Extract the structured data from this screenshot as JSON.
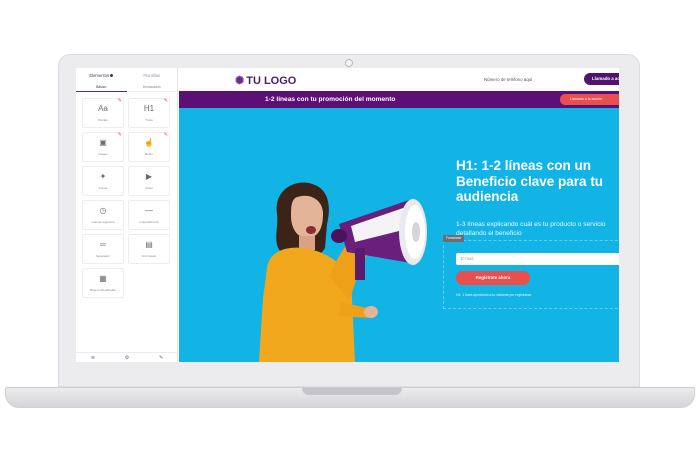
{
  "sidebar": {
    "tabs": [
      {
        "label": "Elementos"
      },
      {
        "label": "Plantillas"
      }
    ],
    "subtabs": [
      {
        "label": "Básico"
      },
      {
        "label": "Destacados"
      }
    ],
    "tiles": [
      {
        "label": "Párrafo",
        "icon": "text-icon",
        "glyph": "Aa"
      },
      {
        "label": "Título",
        "icon": "heading-icon",
        "glyph": "H1"
      },
      {
        "label": "Imagen",
        "icon": "image-icon",
        "glyph": "▣"
      },
      {
        "label": "Botón",
        "icon": "hand-pointer-icon",
        "glyph": "☝"
      },
      {
        "label": "Iconos",
        "icon": "shapes-icon",
        "glyph": "✦"
      },
      {
        "label": "Video",
        "icon": "video-icon",
        "glyph": "▶"
      },
      {
        "label": "Cuenta regresiva",
        "icon": "timer-icon",
        "glyph": "◷"
      },
      {
        "label": "Línea divisoria",
        "icon": "divider-icon",
        "glyph": "—"
      },
      {
        "label": "Separador",
        "icon": "spacer-icon",
        "glyph": "═"
      },
      {
        "label": "Formulario",
        "icon": "form-icon",
        "glyph": "▤"
      },
      {
        "label": "Bloque Reutilizable",
        "icon": "reusable-block-icon",
        "glyph": "▦"
      }
    ],
    "bottom_icons": [
      "layers-icon",
      "settings-icon",
      "brush-icon"
    ]
  },
  "topbar": {
    "logo_text": "TU LOGO",
    "phone": "Número de teléfono aquí",
    "cta": "Llamado a acción"
  },
  "promo": {
    "text": "1-2 líneas con tu promoción del momento",
    "button": "Llamado a la acción"
  },
  "hero": {
    "h1": "H1: 1-2 líneas con un Beneficio clave para tu audiencia",
    "sub": "1-3 líneas explicando cuál es tu producto o servicio detallando el beneficio",
    "form_tag": "Formulario",
    "email_placeholder": "E-mail",
    "register": "Regístrate ahora",
    "fine_print": "H4: 1 línea aportando a tu visitante por registrarse"
  },
  "colors": {
    "brand_purple": "#5c0f74",
    "hero_blue": "#12b4e6",
    "cta_red": "#e94f4c",
    "sweater_yellow": "#f2a81d"
  }
}
